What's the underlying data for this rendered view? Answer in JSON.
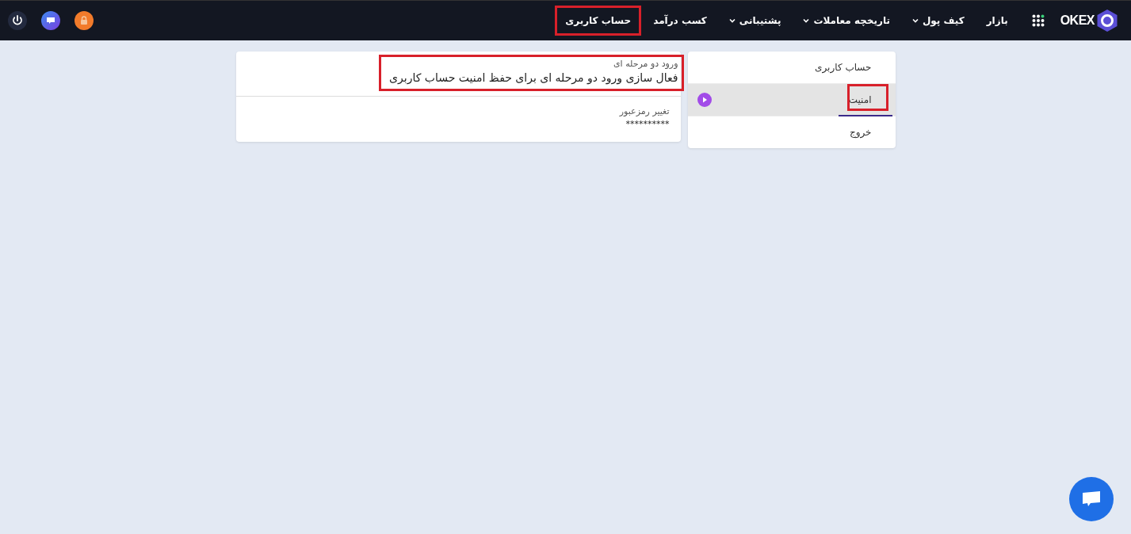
{
  "nav": {
    "logo": "OKEX",
    "items": [
      {
        "label": "بازار",
        "dropdown": false,
        "highlighted": false
      },
      {
        "label": "کیف پول",
        "dropdown": true,
        "highlighted": false
      },
      {
        "label": "تاریخچه معاملات",
        "dropdown": true,
        "highlighted": false
      },
      {
        "label": "پشتیبانی",
        "dropdown": true,
        "highlighted": false
      },
      {
        "label": "کسب درآمد",
        "dropdown": false,
        "highlighted": false
      },
      {
        "label": "حساب کاربری",
        "dropdown": false,
        "highlighted": true
      }
    ]
  },
  "sidebar": {
    "items": [
      {
        "label": "حساب کاربری",
        "selected": false,
        "highlighted": false
      },
      {
        "label": "امنیت",
        "selected": true,
        "highlighted": true
      },
      {
        "label": "خروج",
        "selected": false,
        "highlighted": false
      }
    ]
  },
  "settings": [
    {
      "label": "ورود دو مرحله ای",
      "value": "فعال سازی ورود دو مرحله ای برای حفظ امنیت حساب کاربری",
      "highlighted": true
    },
    {
      "label": "تغییر رمزعبور",
      "value": "**********",
      "highlighted": false
    }
  ]
}
